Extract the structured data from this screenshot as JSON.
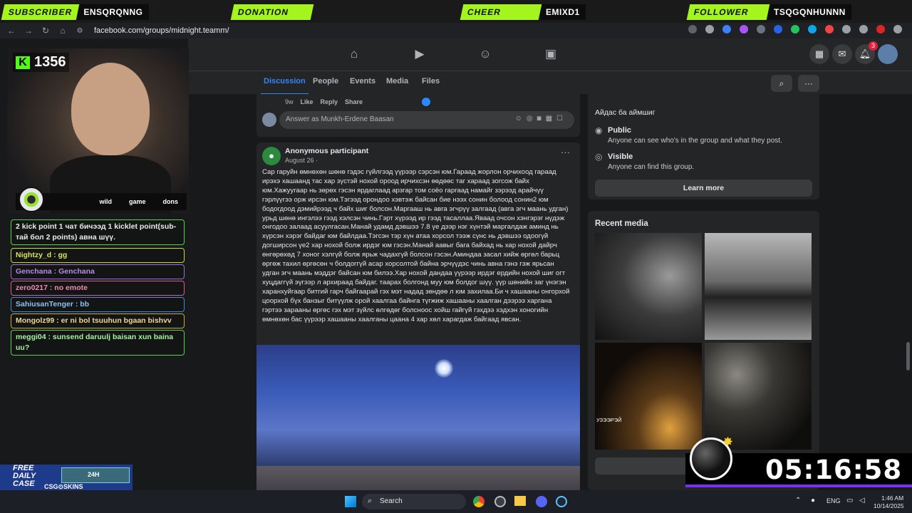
{
  "alerts": {
    "subscriber_label": "SUBSCRIBER",
    "subscriber_name": "ENSQRQNNG",
    "donation_label": "DONATION",
    "cheer_label": "CHEER",
    "cheer_name": "EMIXD1",
    "follower_label": "FOLLOWER",
    "follower_name": "TSQGQNHUNNN",
    "accent_color": "#a4f51e"
  },
  "browser": {
    "url": "facebook.com/groups/midnight.teamm/"
  },
  "fb_nav": {
    "notif_count": "3"
  },
  "group_tabs": [
    "Discussion",
    "People",
    "Events",
    "Media",
    "Files"
  ],
  "comment": {
    "time": "9w",
    "like": "Like",
    "reply": "Reply",
    "share": "Share",
    "composer_placeholder": "Answer as Munkh-Erdene Baasan"
  },
  "post": {
    "author": "Anonymous participant",
    "date": "August 26 · ",
    "text": "Сар гаруйн өмнөхөн шөнө гэдэс гүйлгээд үүрээр сэрсэн юм.Гараад жорлон орчихоод гараад ирэхэ хашаанд тас хар зүстэй нохой ороод ирчихсэн өөдөөс тaг хараад зогсож байх юм.Хажуугаар нь зөрөх гэсэн ярдаглаад арзгар том соёо гаргаад намайг зэрээд арайчүү гэрлүүгээ орж ирсэн юм.Тэгээд орондоо хэвтэж байсан бие нээх сонин болоод сонин2 юм бодогдоод дэмийрээд ч байх шиг болсон.Маргааш нь авга эгчрүү залгаад (авга эгч маань удган) урьд шөнө ингэлээ гээд хэлсэн чинь.Гэрт хүрээд ир гээд тасаллаа.Яваад очсон хэнгэрэг нүдэж онгодоо залаад асуулгасан.Манай удамд дэвшээ 7.8 үе дээр нэг хүнтэй маргалдаж аминд нь хүрсэн хэрэг байдаг юм байлдаа.Тэгсэн тэр хүн атаа хорсол тээж сүнс нь дэвшээ одоогүй догширсон үе2 хар нохой болж ирдэг юм гэсэн.Манай аавыг бага байхад нь хар нохой дайрч өнгөрөхөд 7 хоног хэлгүй болж ярьж чадахгүй болсон гэсэн.Аминдаа засал хийж өргөл барьц өргөж тахил өргөсөн ч болдоггүй асар хорсолтой байна эрчүүдэс чинь авна гэнэ гэж ярьсан удган эгч маань мэддэг байсан юм билээ.Хар нохой дандаа үүрээр ирдэг ердийн нохой шиг огт хуцдаггүй эүгээр л архираад байдаг. таарах болгонд муу юм болдог шүү. үүр шөнийн заг үнэгэн харанхуйгаар битгий гарч байгаарай гэх мэт надад зөндөө л юм захилаа.Би ч хашааны онгорхой цоорхой бүх банзыг битүүлж орой хаалгаа байнга түгжиж хашааны хаалган дээрээ харгана гэртээ зарааны өргөс гэх мэт зүйлс өлгөдөг болсноос хойш гайгүй гэхдээ хэдхэн хоногийн өмнөхөн бас үүрээр хашааны хаалганы цаана 4 хар хөл харагдаж байгаад явсан."
  },
  "about": {
    "top_label": "Айдас ба аймшиг",
    "public_title": "Public",
    "public_desc": "Anyone can see who's in the group and what they post.",
    "visible_title": "Visible",
    "visible_desc": "Anyone can find this group.",
    "learn_more": "Learn more"
  },
  "recent_media": {
    "title": "Recent media",
    "overlay_text": "УЗЭЭРЭЙ"
  },
  "stream": {
    "kick_count": "1356",
    "commands": [
      "wild",
      "game",
      "dons"
    ],
    "chat": [
      {
        "text": "2 kick point 1 чат бичээд 1 kicklet point(sub-тай бол 2 points) авна шүү.",
        "color": "#5ad14b"
      },
      {
        "text": "Nightzy_d : gg",
        "color": "#c9d93a"
      },
      {
        "text": "Genchana : Genchana",
        "color": "#9b6dd6"
      },
      {
        "text": "zero0217 : no emote",
        "color": "#e05a8d"
      },
      {
        "text": "SahiusanTenger : bb",
        "color": "#3a8ed9"
      },
      {
        "text": "Mongolz99 : er ni bol tsuuhun bgaan bishvv",
        "color": "#c9a93a"
      },
      {
        "text": "meggi04 : sunsend daruulj baisan xun baina uu?",
        "color": "#5ad14b"
      }
    ],
    "promo": {
      "line1": "FREE",
      "line2": "DAILY",
      "line3": "CASE",
      "brand": "CSG⊙SKINS",
      "box": "24H"
    },
    "timer": "05:16:58"
  },
  "taskbar": {
    "search": "Search",
    "lang": "ENG",
    "time": "1:46 AM",
    "date": "10/14/2025"
  }
}
